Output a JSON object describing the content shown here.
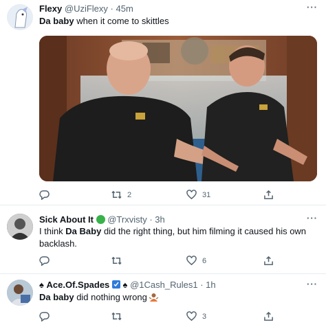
{
  "tweets": [
    {
      "name": "Flexy",
      "handle": "@UziFlexy",
      "time": "45m",
      "text_bold": "Da baby",
      "text_rest": " when it come to skittles",
      "replies": "",
      "retweets": "2",
      "likes": "31"
    },
    {
      "name": "Sick About It",
      "handle": "@Trxvisty",
      "time": "3h",
      "text_a": "I think ",
      "text_bold": "Da Baby",
      "text_b": " did the right thing, but him filming it caused his own",
      "text_line2": "backlash.",
      "replies": "",
      "retweets": "",
      "likes": "6"
    },
    {
      "name": "Ace.Of.Spades",
      "handle": "@1Cash_Rules1",
      "time": "1h",
      "text_bold": "Da baby",
      "text_rest": " did nothing wrong",
      "replies": "",
      "retweets": "",
      "likes": "3"
    }
  ],
  "separator": "·",
  "more_glyph": "···",
  "colors": {
    "secondary_text": "#536471",
    "divider": "#e6ecf0",
    "shirt": "#1c1d1c",
    "wall": "#7a4a32"
  },
  "icons": [
    "reply-icon",
    "retweet-icon",
    "like-icon",
    "share-icon",
    "more-icon",
    "verified-blue-icon",
    "spade-icon",
    "sick-emoji-icon",
    "person-shrug-emoji-icon"
  ]
}
